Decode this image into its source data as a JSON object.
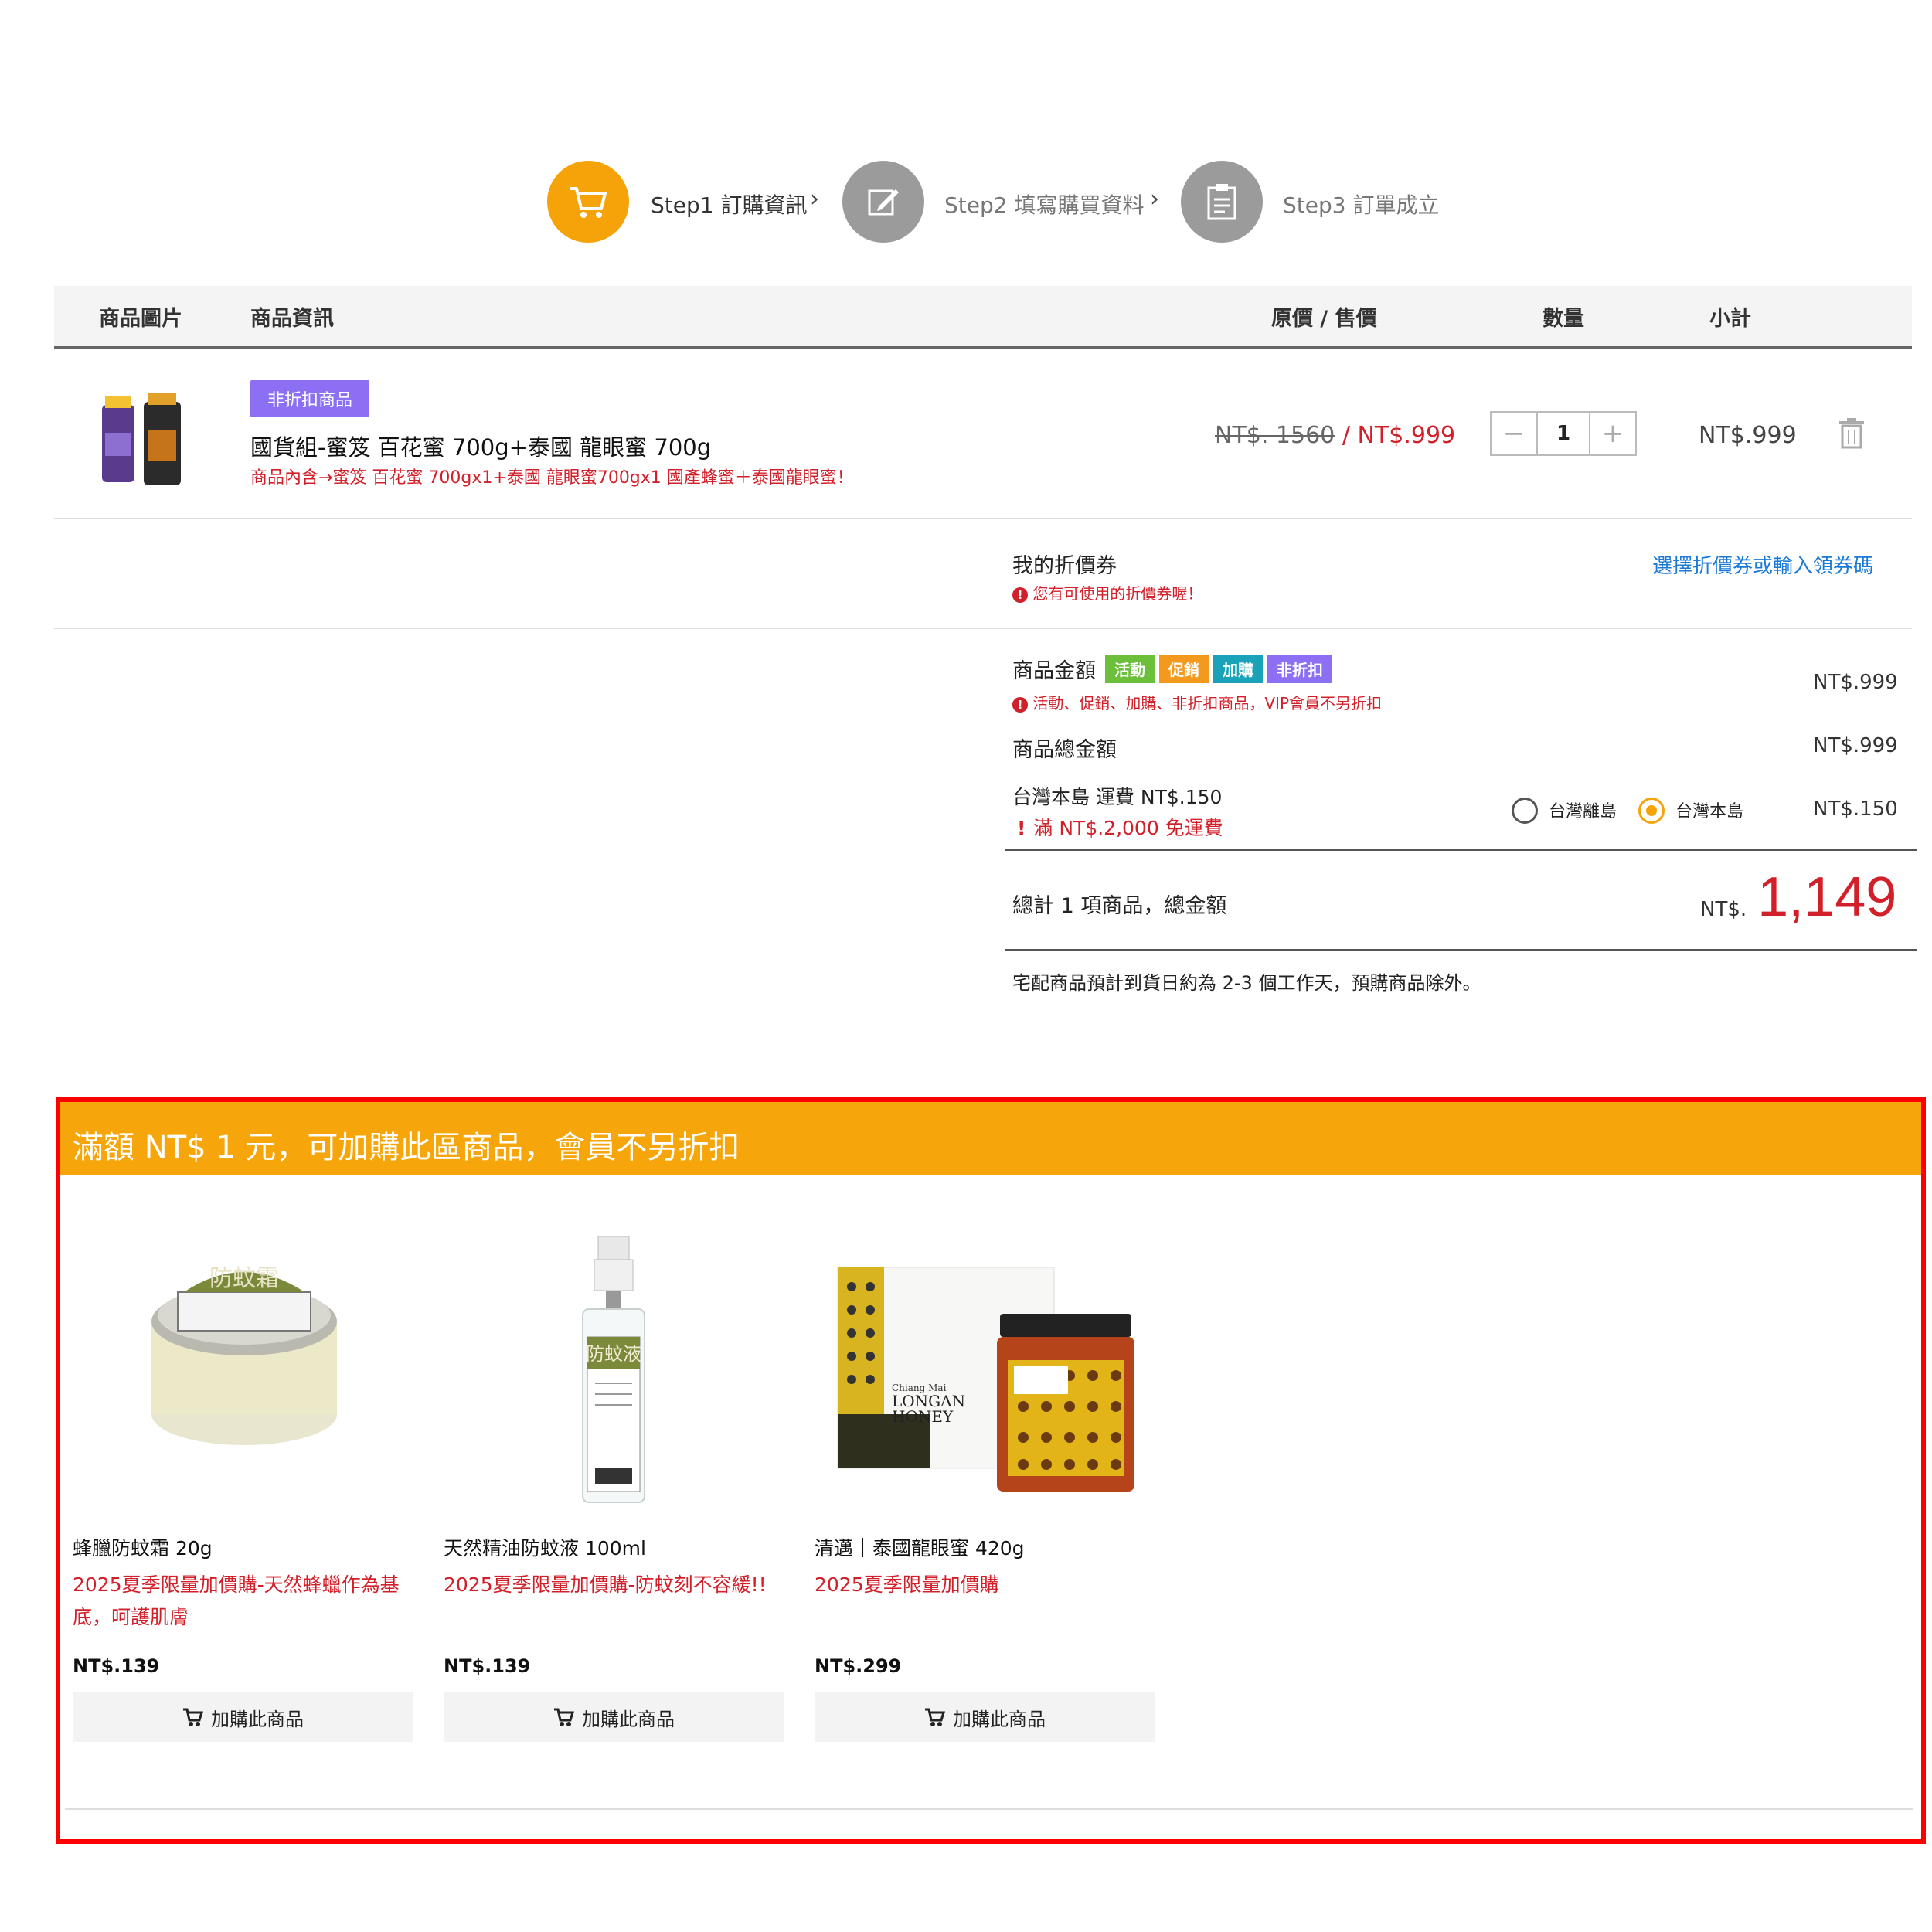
{
  "steps": [
    {
      "label": "Step1 訂購資訊",
      "state": "active",
      "icon": "cart-icon"
    },
    {
      "label": "Step2 填寫購買資料",
      "state": "inactive",
      "icon": "edit-icon"
    },
    {
      "label": "Step3 訂單成立",
      "state": "inactive",
      "icon": "clipboard-icon"
    }
  ],
  "step_arrow": "›",
  "table_headers": {
    "image": "商品圖片",
    "info": "商品資訊",
    "price": "原價 / 售價",
    "qty": "數量",
    "subtotal": "小計"
  },
  "cart_item": {
    "badge": "非折扣商品",
    "name": "國貨組-蜜笈 百花蜜 700g+泰國 龍眼蜜 700g",
    "description": "商品內含→蜜笈 百花蜜 700gx1+泰國 龍眼蜜700gx1 國產蜂蜜＋泰國龍眼蜜！",
    "original_price": "NT$. 1560",
    "separator": " / ",
    "sale_price": "NT$.999",
    "quantity": "1",
    "qty_minus": "−",
    "qty_plus": "+",
    "subtotal": "NT$.999"
  },
  "coupon": {
    "title": "我的折價券",
    "notice": "您有可使用的折價券喔！",
    "link": "選擇折價券或輸入領券碼"
  },
  "summary": {
    "goods_amount_label": "商品金額",
    "tags": [
      {
        "text": "活動",
        "color": "#6bbf3a"
      },
      {
        "text": "促銷",
        "color": "#f39a1e"
      },
      {
        "text": "加購",
        "color": "#1aa3b8"
      },
      {
        "text": "非折扣",
        "color": "#8c6ff2"
      }
    ],
    "goods_note": "活動、促銷、加購、非折扣商品，VIP會員不另折扣",
    "goods_amount": "NT$.999",
    "goods_total_label": "商品總金額",
    "goods_total": "NT$.999",
    "shipping_label": "台灣本島 運費 NT$.150",
    "shipping_free_note": "滿 NT$.2,000 免運費",
    "shipping_options": [
      {
        "label": "台灣離島",
        "selected": false
      },
      {
        "label": "台灣本島",
        "selected": true
      }
    ],
    "shipping_amount": "NT$.150",
    "total_label": "總計 1 項商品，總金額",
    "total_currency": "NT$.",
    "total_amount": "1,149",
    "delivery_note": "宅配商品預計到貨日約為 2-3 個工作天，預購商品除外。"
  },
  "addon": {
    "title": "滿額 NT$ 1 元，可加購此區商品，會員不另折扣",
    "button_label": "加購此商品",
    "items": [
      {
        "name": "蜂臘防蚊霜 20g",
        "promo": "2025夏季限量加價購-天然蜂蠟作為基底，呵護肌膚",
        "price": "NT$.139"
      },
      {
        "name": "天然精油防蚊液 100ml",
        "promo": "2025夏季限量加價購-防蚊刻不容緩!!",
        "price": "NT$.139"
      },
      {
        "name": "清邁｜泰國龍眼蜜 420g",
        "promo": "2025夏季限量加價購",
        "price": "NT$.299"
      }
    ],
    "honey_box_text": [
      "Chiang Mai",
      "LONGAN",
      "HONEY"
    ],
    "balm_label": "防蚊霜",
    "spray_label": "防蚊液"
  }
}
